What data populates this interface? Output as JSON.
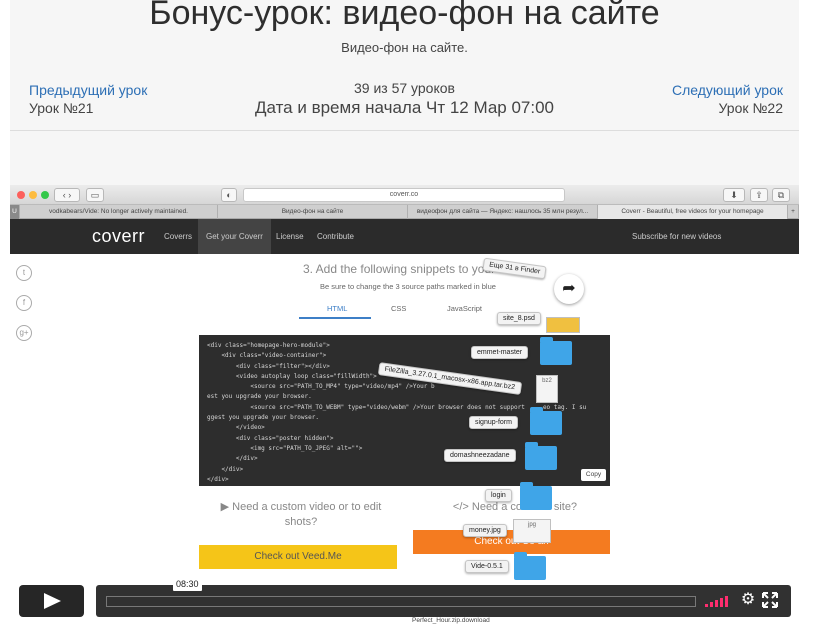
{
  "lesson": {
    "title": "Бонус-урок: видео-фон на сайте",
    "subtitle": "Видео-фон на сайте.",
    "prev_link": "Предыдущий урок",
    "prev_number": "Урок №21",
    "next_link": "Следующий урок",
    "next_number": "Урок №22",
    "counter": "39 из 57 уроков",
    "start_time": "Дата и время начала Чт 12 Мар 07:00"
  },
  "browser": {
    "url": "coverr.co",
    "tabs": [
      "vodkabears/Vide: No longer actively maintained.",
      "Видео-фон на сайте",
      "видеофон для сайта — Яндекс: нашлось 35 млн резул...",
      "Coverr - Beautiful, free videos for your homepage"
    ]
  },
  "site": {
    "logo": "coverr",
    "nav": [
      "Coverrs",
      "Get your Coverr",
      "License",
      "Contribute"
    ],
    "nav_right": "Subscribe for new videos",
    "step_heading": "3. Add the following snippets to your",
    "step_note": "Be sure to change the 3 source paths marked in blue",
    "code_tabs": [
      "HTML",
      "CSS",
      "JavaScript"
    ],
    "code_lines": [
      "<div class=\"homepage-hero-module\">",
      "    <div class=\"video-container\">",
      "        <div class=\"filter\"></div>",
      "        <video autoplay loop class=\"fillWidth\">",
      "            <source src=\"PATH_TO_MP4\" type=\"video/mp4\" />Your b             tag. I sugg",
      "est you upgrade your browser.",
      "            <source src=\"PATH_TO_WEBM\" type=\"video/webm\" />Your browser does not support     eo tag. I su",
      "ggest you upgrade your browser.",
      "        </video>",
      "        <div class=\"poster hidden\">",
      "            <img src=\"PATH_TO_JPEG\" alt=\"\">",
      "        </div>",
      "    </div>",
      "</div>"
    ],
    "copy_label": "Copy",
    "promo_left": "▶ Need a custom video or to edit shots?",
    "promo_right": "</> Need a coder          ur site?",
    "veed_button": "Check out Veed.Me",
    "orange_button": "Check out Co          an"
  },
  "finder_overlay": {
    "items": [
      "Еще 31 в Finder",
      "site_8.psd",
      "emmet-master",
      "FileZilla_3.27.0.1_macosx-x86.app.tar.bz2",
      "signup-form",
      "domashneezadane",
      "login",
      "money.jpg",
      "Vide-0.5.1"
    ],
    "bottom_label": "Perfect_Hour.zip.download"
  },
  "player": {
    "time_tooltip": "08:30",
    "progress": 0.0
  },
  "colors": {
    "header_bg": "#f6f6f6",
    "link": "#2d6fb5",
    "volume_active": "#ff2d6f",
    "veed_yellow": "#f5c518",
    "coverr_orange": "#f47b20",
    "folder_blue": "#3fa5e8"
  }
}
